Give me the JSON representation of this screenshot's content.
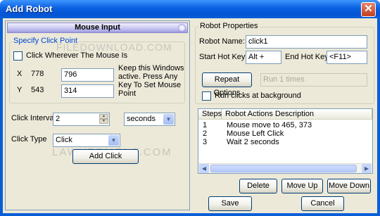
{
  "window": {
    "title": "Add Robot",
    "close_glyph": "✕"
  },
  "mouse_input": {
    "header": "Mouse Input",
    "group_label": "Specify Click Point",
    "checkbox_label": "Click Wherever The Mouse Is",
    "watermark": "FILEDOWNLOAD.COM",
    "x_label": "X",
    "x_current": "778",
    "x_value": "796",
    "y_label": "Y",
    "y_current": "543",
    "y_value": "314",
    "instructions": [
      "Keep this Windows",
      "active. Press Any",
      "Key To Set Mouse",
      "Point"
    ],
    "interval_label": "Click Interval",
    "interval_value": "2",
    "interval_unit": "seconds",
    "type_label": "Click Type",
    "type_value": "Click",
    "add_button": "Add Click",
    "watermark2": "LAWYERMENT.COM"
  },
  "properties": {
    "group_label": "Robot Properties",
    "name_label": "Robot Name:",
    "name_value": "click1",
    "start_label": "Start Hot Key:",
    "start_value": "Alt +",
    "end_label": "End Hot Key:",
    "end_value": "<F11>",
    "repeat_button": "Repeat Options",
    "repeat_value": "Run 1 times",
    "background_label": "Run clicks at background"
  },
  "actions": {
    "columns": [
      "Steps",
      "Robot Actions Description"
    ],
    "rows": [
      {
        "step": "1",
        "desc": "Mouse move to 465, 373"
      },
      {
        "step": "2",
        "desc": "Mouse Left Click"
      },
      {
        "step": "3",
        "desc": "Wait 2 seconds"
      }
    ],
    "delete": "Delete",
    "move_up": "Move Up",
    "move_down": "Move Down"
  },
  "footer": {
    "save": "Save",
    "cancel": "Cancel"
  }
}
